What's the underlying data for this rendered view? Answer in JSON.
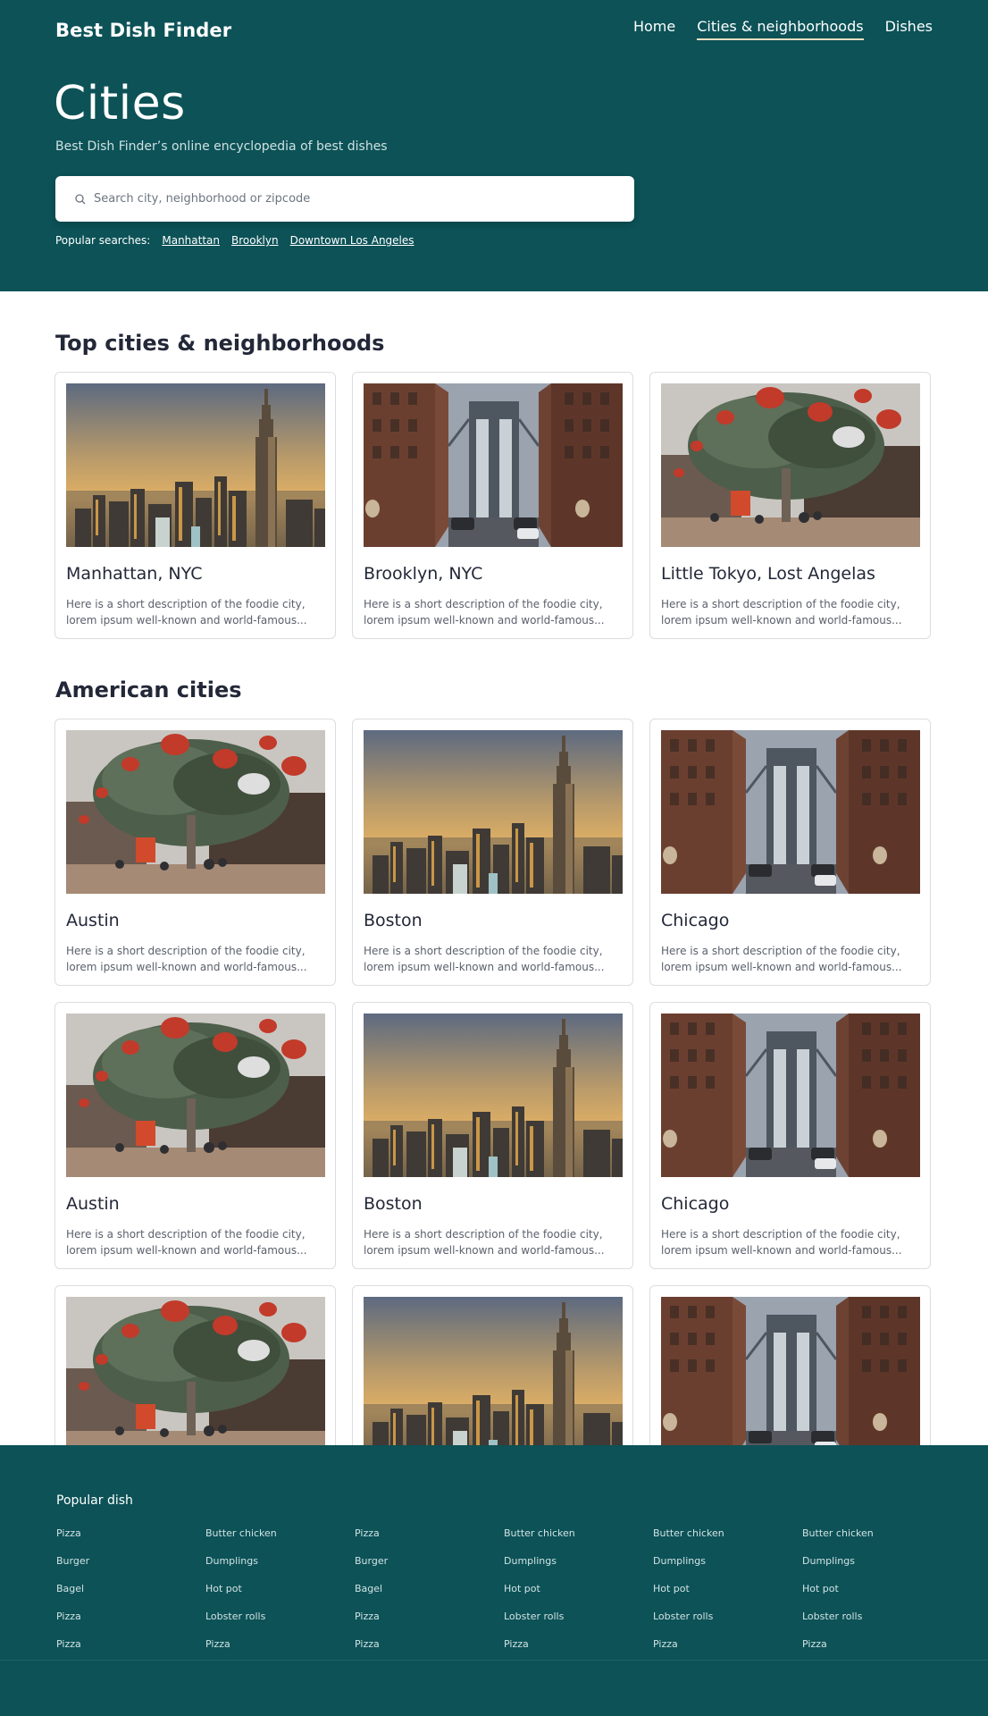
{
  "header": {
    "brand": "Best Dish Finder",
    "nav": [
      {
        "label": "Home",
        "active": false
      },
      {
        "label": "Cities & neighborhoods",
        "active": true
      },
      {
        "label": "Dishes",
        "active": false
      }
    ]
  },
  "hero": {
    "title": "Cities",
    "subtitle": "Best Dish Finder’s online encyclopedia of best dishes",
    "search_placeholder": "Search city, neighborhood or zipcode",
    "popular_label": "Popular searches:",
    "popular": [
      "Manhattan",
      "Brooklyn",
      "Downtown Los Angeles"
    ]
  },
  "top_section": {
    "title": "Top cities & neighborhoods",
    "cards": [
      {
        "title": "Manhattan, NYC",
        "image": "skyline-photo",
        "desc1": "Here is a short description of the foodie city,",
        "desc2": "lorem ipsum well-known and world-famous..."
      },
      {
        "title": "Brooklyn, NYC",
        "image": "bridge-street-photo",
        "desc1": "Here is a short description of the foodie city,",
        "desc2": "lorem ipsum well-known and world-famous..."
      },
      {
        "title": "Little Tokyo, Lost Angelas",
        "image": "lantern-tree-photo",
        "desc1": "Here is a short description of the foodie city,",
        "desc2": "lorem ipsum well-known and world-famous..."
      }
    ]
  },
  "american_section": {
    "title": "American cities",
    "cards": [
      {
        "title": "Austin",
        "image": "lantern-tree-photo",
        "desc1": "Here is a short description of the foodie city,",
        "desc2": "lorem ipsum well-known and world-famous..."
      },
      {
        "title": "Boston",
        "image": "skyline-photo",
        "desc1": "Here is a short description of the foodie city,",
        "desc2": "lorem ipsum well-known and world-famous..."
      },
      {
        "title": "Chicago",
        "image": "bridge-street-photo",
        "desc1": "Here is a short description of the foodie city,",
        "desc2": "lorem ipsum well-known and world-famous..."
      },
      {
        "title": "Austin",
        "image": "lantern-tree-photo",
        "desc1": "Here is a short description of the foodie city,",
        "desc2": "lorem ipsum well-known and world-famous..."
      },
      {
        "title": "Boston",
        "image": "skyline-photo",
        "desc1": "Here is a short description of the foodie city,",
        "desc2": "lorem ipsum well-known and world-famous..."
      },
      {
        "title": "Chicago",
        "image": "bridge-street-photo",
        "desc1": "Here is a short description of the foodie city,",
        "desc2": "lorem ipsum well-known and world-famous..."
      },
      {
        "title": "",
        "image": "lantern-tree-photo",
        "desc1": "",
        "desc2": ""
      },
      {
        "title": "",
        "image": "skyline-photo",
        "desc1": "",
        "desc2": ""
      },
      {
        "title": "",
        "image": "bridge-street-photo",
        "desc1": "",
        "desc2": ""
      }
    ]
  },
  "footer": {
    "title": "Popular dish",
    "columns": [
      [
        "Pizza",
        "Burger",
        "Bagel",
        "Pizza",
        "Pizza"
      ],
      [
        "Butter chicken",
        "Dumplings",
        "Hot pot",
        "Lobster rolls",
        "Pizza"
      ],
      [
        "Pizza",
        "Burger",
        "Bagel",
        "Pizza",
        "Pizza"
      ],
      [
        "Butter chicken",
        "Dumplings",
        "Hot pot",
        "Lobster rolls",
        "Pizza"
      ],
      [
        "Butter chicken",
        "Dumplings",
        "Hot pot",
        "Lobster rolls",
        "Pizza"
      ],
      [
        "Butter chicken",
        "Dumplings",
        "Hot pot",
        "Lobster rolls",
        "Pizza"
      ]
    ]
  },
  "colors": {
    "brand_teal": "#0c5257",
    "nav_underline": "#f0dfc0",
    "heading": "#232838"
  }
}
